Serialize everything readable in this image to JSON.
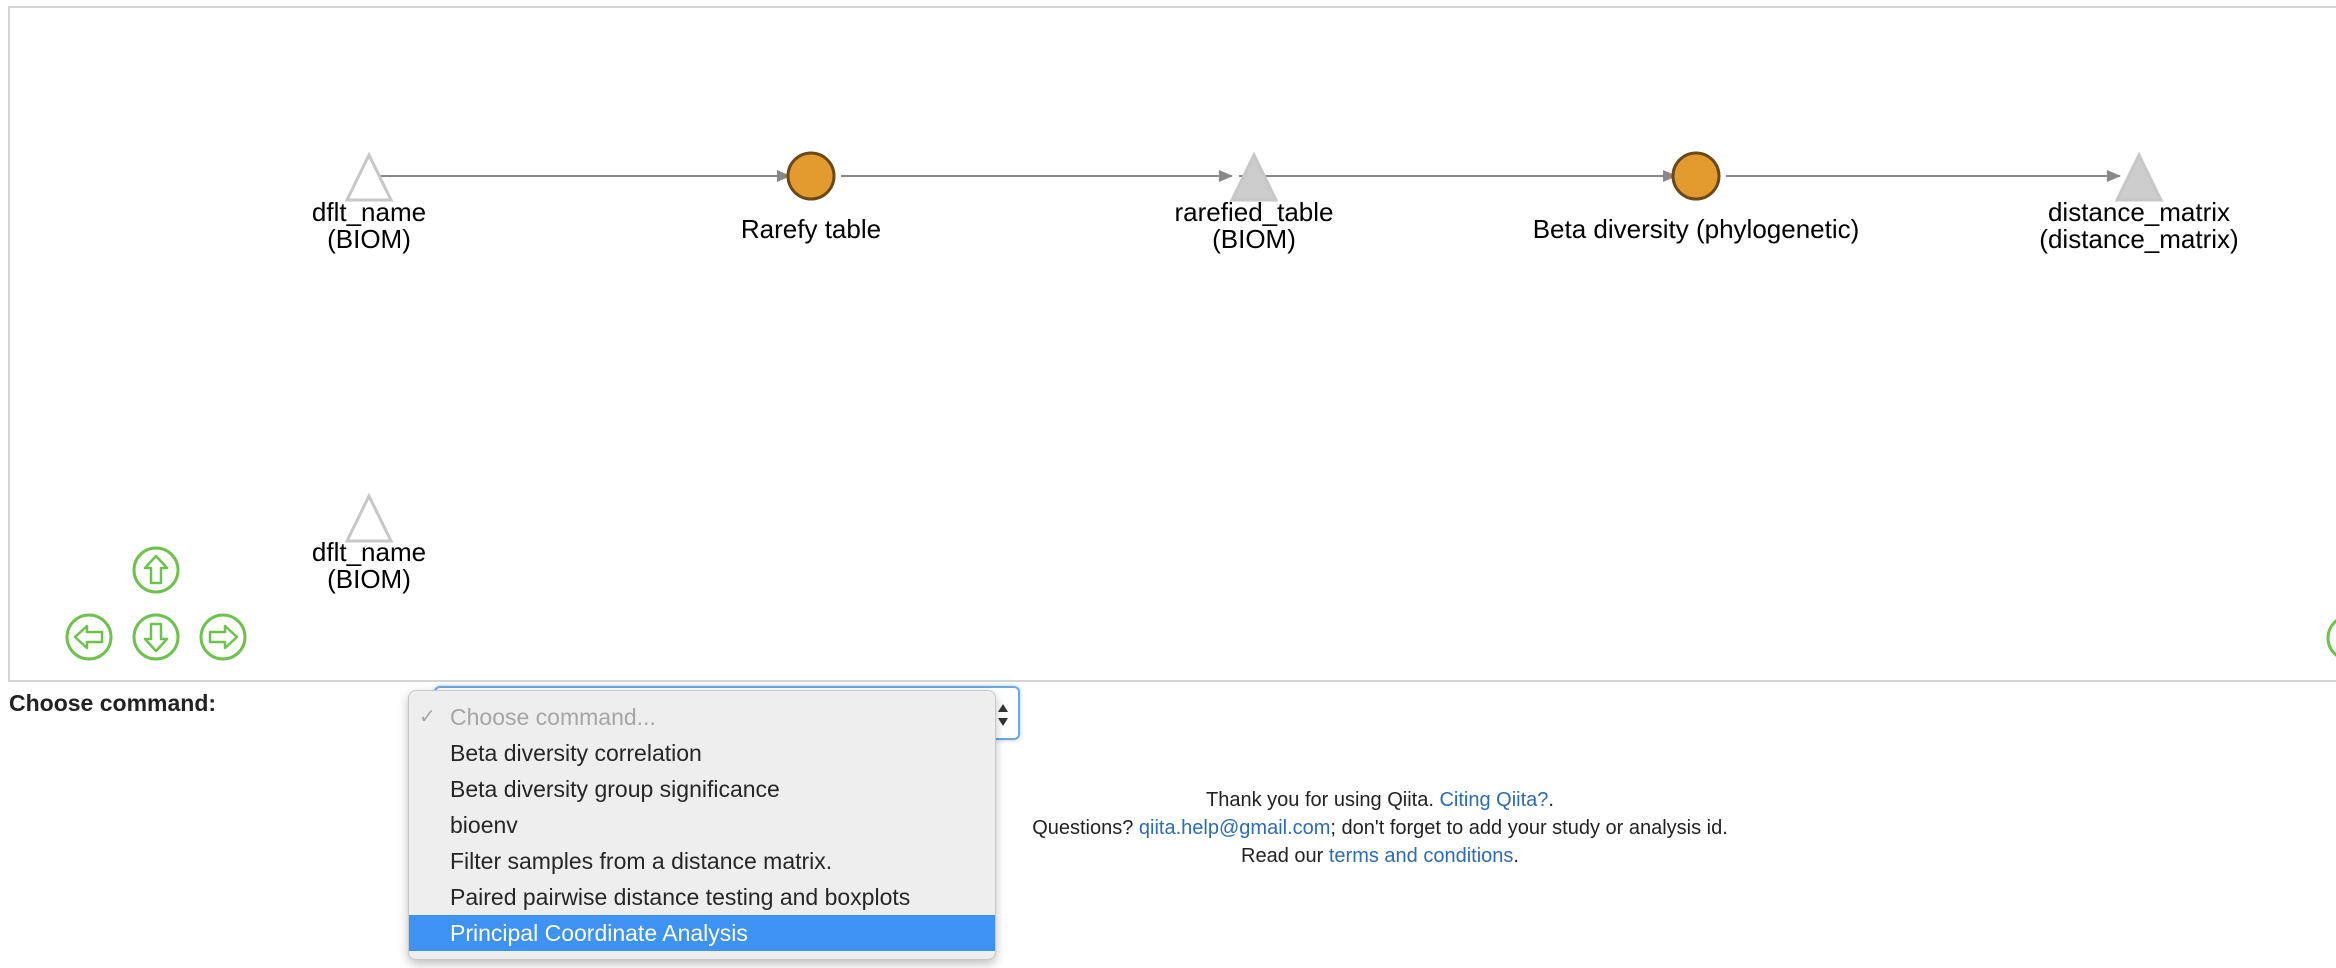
{
  "network": {
    "nodes": [
      {
        "id": "artifact-biom-1",
        "kind": "artifact",
        "line1": "dflt_name",
        "line2": "(BIOM)",
        "color": "#ffffff"
      },
      {
        "id": "job-rarefy",
        "kind": "job",
        "line1": "Rarefy table",
        "line2": "",
        "color": "#e39a2f"
      },
      {
        "id": "artifact-rarefied",
        "kind": "artifact",
        "line1": "rarefied_table",
        "line2": "(BIOM)",
        "color": "#cccccc"
      },
      {
        "id": "job-beta",
        "kind": "job",
        "line1": "Beta diversity (phylogenetic)",
        "line2": "",
        "color": "#e39a2f"
      },
      {
        "id": "artifact-distance",
        "kind": "artifact",
        "line1": "distance_matrix",
        "line2": "(distance_matrix)",
        "color": "#cccccc"
      },
      {
        "id": "artifact-biom-2",
        "kind": "artifact",
        "line1": "dflt_name",
        "line2": "(BIOM)",
        "color": "#ffffff"
      }
    ],
    "controls": {
      "up": "arrow-up-icon",
      "left": "arrow-left-icon",
      "down": "arrow-down-icon",
      "right": "arrow-right-icon",
      "color": "#6cc24a"
    }
  },
  "command": {
    "label": "Choose command:",
    "placeholder": "Choose command...",
    "options": [
      "Beta diversity correlation",
      "Beta diversity group significance",
      "bioenv",
      "Filter samples from a distance matrix.",
      "Paired pairwise distance testing and boxplots",
      "Principal Coordinate Analysis"
    ],
    "highlighted": "Principal Coordinate Analysis"
  },
  "footer": {
    "thanks": "Thank you for using Qiita.",
    "citing_link": "Citing Qiita?",
    "questions": "Questions?",
    "email": "qiita.help@gmail.com",
    "reminder": "; don't forget to add your study or analysis id.",
    "read": "Read our",
    "terms_link": "terms and conditions",
    "period": "."
  },
  "colors": {
    "job_node": "#e39a2f",
    "highlight": "#3e92f2",
    "link": "#2b6cb5",
    "nav_green": "#6cc24a"
  }
}
